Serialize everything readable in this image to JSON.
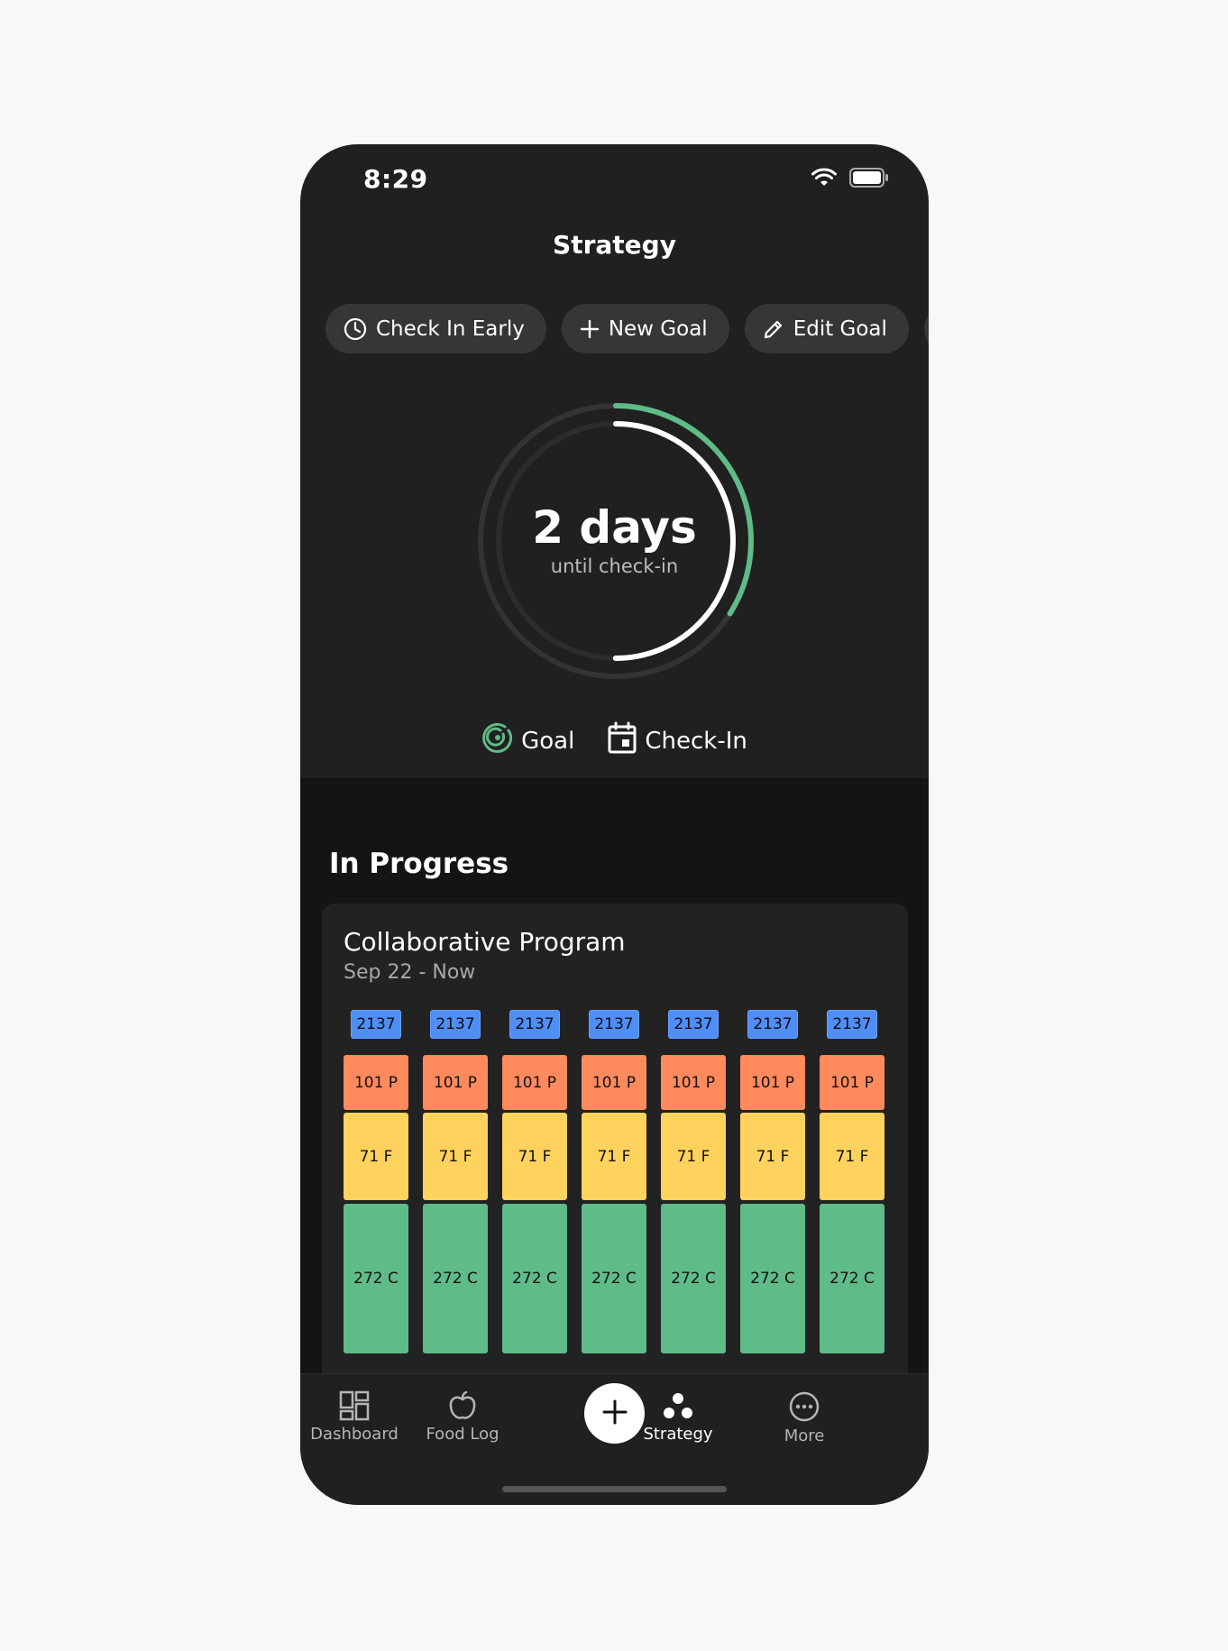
{
  "status": {
    "time": "8:29"
  },
  "header": {
    "title": "Strategy"
  },
  "actions": [
    {
      "label": "Check In Early",
      "icon": "clock-icon"
    },
    {
      "label": "New Goal",
      "icon": "plus-icon"
    },
    {
      "label": "Edit Goal",
      "icon": "pencil-icon"
    }
  ],
  "countdown": {
    "value": "2 days",
    "caption": "until check-in",
    "goal_progress": 0.34,
    "checkin_progress": 0.5,
    "colors": {
      "goal": "#5fbb87",
      "checkin": "#ffffff",
      "track": "#3a3a3a"
    }
  },
  "legend": {
    "goal": "Goal",
    "checkin": "Check-In"
  },
  "in_progress": {
    "title": "In Progress",
    "program": {
      "name": "Collaborative Program",
      "dates": "Sep 22 - Now",
      "days": [
        {
          "calories": "2137",
          "protein": "101 P",
          "fat": "71 F",
          "carbs": "272 C"
        },
        {
          "calories": "2137",
          "protein": "101 P",
          "fat": "71 F",
          "carbs": "272 C"
        },
        {
          "calories": "2137",
          "protein": "101 P",
          "fat": "71 F",
          "carbs": "272 C"
        },
        {
          "calories": "2137",
          "protein": "101 P",
          "fat": "71 F",
          "carbs": "272 C"
        },
        {
          "calories": "2137",
          "protein": "101 P",
          "fat": "71 F",
          "carbs": "272 C"
        },
        {
          "calories": "2137",
          "protein": "101 P",
          "fat": "71 F",
          "carbs": "272 C"
        },
        {
          "calories": "2137",
          "protein": "101 P",
          "fat": "71 F",
          "carbs": "272 C"
        }
      ]
    }
  },
  "tabbar": {
    "dashboard": "Dashboard",
    "food_log": "Food Log",
    "strategy": "Strategy",
    "more": "More"
  }
}
